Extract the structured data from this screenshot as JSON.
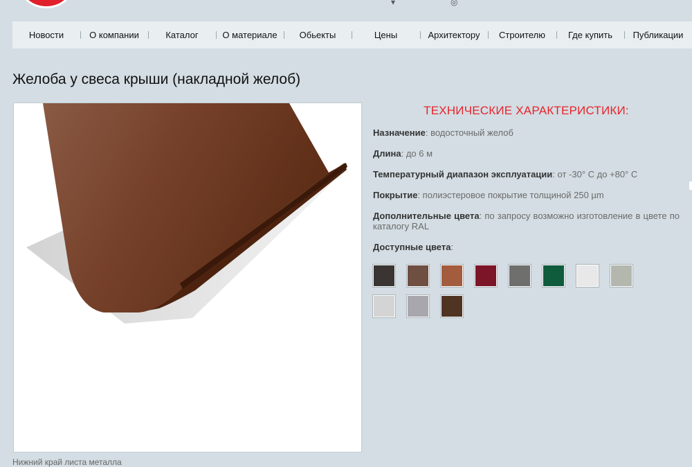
{
  "nav": {
    "items": [
      "Новости",
      "О компании",
      "Каталог",
      "О материале",
      "Обьекты",
      "Цены",
      "Архитектору",
      "Строителю",
      "Где купить",
      "Публикации"
    ]
  },
  "page": {
    "title": "Желоба у свеса крыши (накладной желоб)",
    "caption": "Нижний край листа металла"
  },
  "specs": {
    "title": "ТЕХНИЧЕСКИЕ ХАРАКТЕРИСТИКИ:",
    "rows": [
      {
        "label": "Назначение",
        "value": "водосточный желоб"
      },
      {
        "label": "Длина",
        "value": "до 6 м"
      },
      {
        "label": "Температурный диапазон эксплуатации",
        "value": "от -30° C до +80° C"
      },
      {
        "label": "Покрытие",
        "value": "полиэстеровое покрытие толщиной 250 µm"
      },
      {
        "label": "Дополнительные цвета",
        "value": "по запросу возможно изготовление в цвете по каталогу RAL"
      }
    ],
    "colors_label": "Доступные цвета",
    "colors": [
      "#3a3532",
      "#6e4f42",
      "#a35c3d",
      "#7c1528",
      "#6f6f6d",
      "#0f5c3d",
      "#e8e8e8",
      "#b4b7ae",
      "#d4d4d4",
      "#a9a7ae",
      "#4f3323"
    ]
  },
  "colors": {
    "accent": "#e8232b",
    "background": "#d3dde3",
    "nav_background": "#e9eef1"
  }
}
